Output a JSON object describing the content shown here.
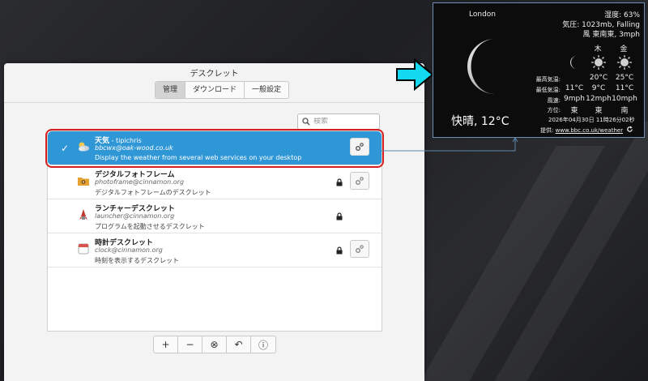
{
  "window": {
    "title": "デスクレット",
    "minimize_glyph": "–"
  },
  "tabs": [
    {
      "label": "管理",
      "active": true
    },
    {
      "label": "ダウンロード",
      "active": false
    },
    {
      "label": "一般設定",
      "active": false
    }
  ],
  "search": {
    "placeholder": "検索",
    "value": ""
  },
  "desklets": [
    {
      "name": "天気",
      "author": " - tipichris",
      "uuid": "bbcwx@oak-wood.co.uk",
      "description": "Display the weather from several web services on your desktop",
      "icon": "weather-icon",
      "selected": true,
      "locked": false,
      "configurable": true
    },
    {
      "name": "デジタルフォトフレーム",
      "author": "",
      "uuid": "photoframe@cinnamon.org",
      "description": "デジタルフォトフレームのデスクレット",
      "icon": "folder-photo-icon",
      "selected": false,
      "locked": true,
      "configurable": true
    },
    {
      "name": "ランチャーデスクレット",
      "author": "",
      "uuid": "launcher@cinnamon.org",
      "description": "プログラムを起動させるデスクレット",
      "icon": "launcher-icon",
      "selected": false,
      "locked": true,
      "configurable": false
    },
    {
      "name": "時計デスクレット",
      "author": "",
      "uuid": "clock@cinnamon.org",
      "description": "時刻を表示するデスクレット",
      "icon": "calendar-icon",
      "selected": false,
      "locked": true,
      "configurable": true
    }
  ],
  "toolbar": {
    "add": "+",
    "remove": "−",
    "clear": "⊗",
    "undo": "↶",
    "info": "ⓘ"
  },
  "weather": {
    "city": "London",
    "condition": "快晴, 12°C",
    "humidity": "湿度: 63%",
    "pressure": "気圧: 1023mb, Falling",
    "wind": "風 東南東, 3mph",
    "days": [
      "",
      "木",
      "金"
    ],
    "labels": {
      "high": "最高気温:",
      "low": "最低気温:",
      "wind": "風速:",
      "direction": "方位:"
    },
    "highs": [
      "",
      "20°C",
      "25°C"
    ],
    "lows": [
      "11°C",
      "9°C",
      "11°C"
    ],
    "winds": [
      "9mph",
      "12mph",
      "10mph"
    ],
    "directions": [
      "東",
      "東",
      "南"
    ],
    "timestamp": "2026年04月30日 11時26分02秒",
    "credit_label": "提供: ",
    "credit_link": "www.bbc.co.uk/weather"
  },
  "colors": {
    "selection": "#2f97d6",
    "highlight_border": "#d62020",
    "arrow": "#12d9f0"
  }
}
